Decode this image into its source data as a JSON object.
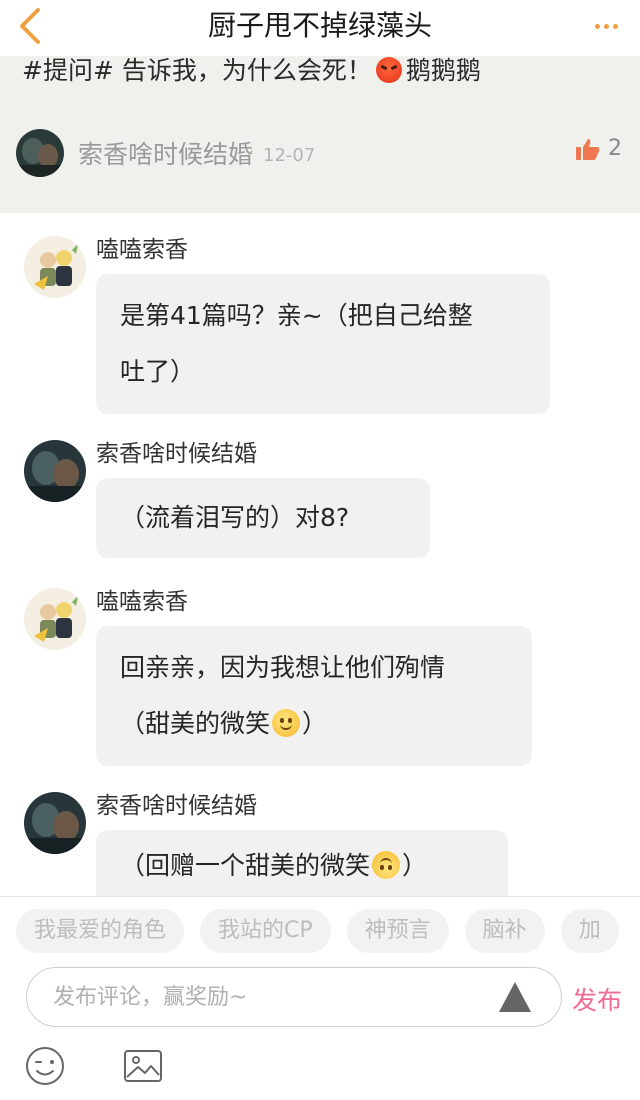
{
  "header": {
    "title": "厨子甩不掉绿藻头",
    "back_icon": "chevron-left-icon",
    "more_icon": "more-dots-icon",
    "accent_color": "#f0a040"
  },
  "post": {
    "text_before": "#提问# 告诉我，为什么会死！",
    "emoji": "angry-face-emoji",
    "text_after": "鹅鹅鹅",
    "author": "索香啥时候结婚",
    "date": "12-07",
    "likes": "2",
    "like_color": "#f07850"
  },
  "comments": [
    {
      "name": "嗑嗑索香",
      "avatar": "sticker-avatar",
      "lines": [
        "是第41篇吗？亲~（把自己给整",
        "吐了）"
      ]
    },
    {
      "name": "索香啥时候结婚",
      "avatar": "dark-photo-avatar",
      "lines": [
        "（流着泪写的）对8?"
      ]
    },
    {
      "name": "嗑嗑索香",
      "avatar": "sticker-avatar",
      "line1": "回亲亲，因为我想让他们殉情",
      "line2_before": "（甜美的微笑",
      "line2_emoji": "smile-emoji",
      "line2_after": "）"
    },
    {
      "name": "索香啥时候结婚",
      "avatar": "dark-photo-avatar",
      "line_before": "（回赠一个甜美的微笑",
      "line_emoji": "upside-down-smile-emoji",
      "line_after": "）"
    }
  ],
  "tags": [
    "我最爱的角色",
    "我站的CP",
    "神预言",
    "脑补",
    "加"
  ],
  "composer": {
    "placeholder": "发布评论，赢奖励~",
    "send_icon": "triangle-up-icon",
    "publish_label": "发布",
    "publish_color": "#f06a92",
    "emoji_icon": "wink-face-icon",
    "image_icon": "image-icon"
  }
}
